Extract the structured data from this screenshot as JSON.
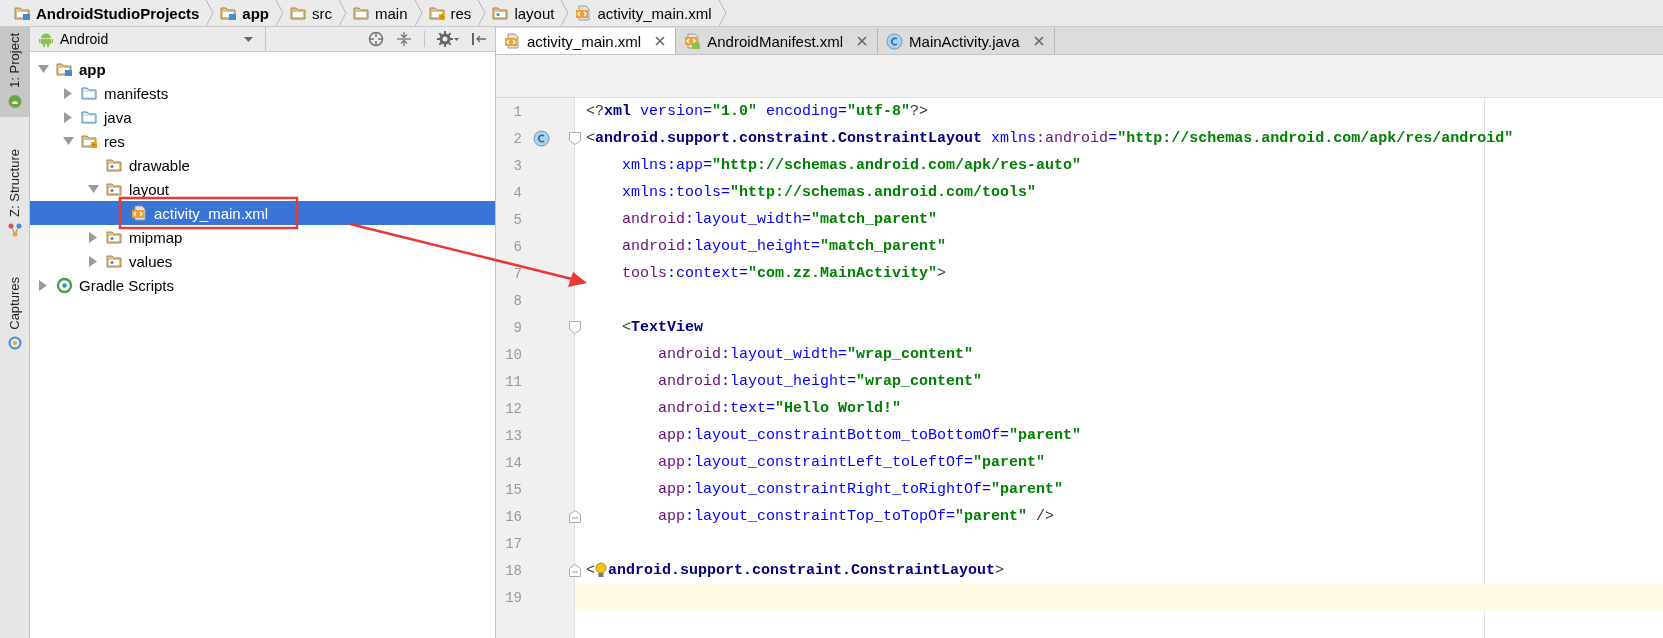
{
  "breadcrumbs": [
    {
      "label": "AndroidStudioProjects",
      "kind": "project"
    },
    {
      "label": "app",
      "kind": "module"
    },
    {
      "label": "src",
      "kind": "folder"
    },
    {
      "label": "main",
      "kind": "folder"
    },
    {
      "label": "res",
      "kind": "res"
    },
    {
      "label": "layout",
      "kind": "resdir"
    },
    {
      "label": "activity_main.xml",
      "kind": "xml"
    }
  ],
  "tool_strip": [
    {
      "label": "1: Project",
      "kind": "project",
      "selected": true
    },
    {
      "label": "Z: Structure",
      "kind": "structure",
      "selected": false
    },
    {
      "label": "Captures",
      "kind": "captures",
      "selected": false
    }
  ],
  "project_panel": {
    "view": "Android",
    "tree": [
      {
        "label": "app",
        "kind": "module",
        "expanded": true,
        "selected": false,
        "children": [
          {
            "label": "manifests",
            "kind": "source",
            "expanded": false,
            "selected": false
          },
          {
            "label": "java",
            "kind": "source",
            "expanded": false,
            "selected": false
          },
          {
            "label": "res",
            "kind": "res",
            "expanded": true,
            "selected": false,
            "children": [
              {
                "label": "drawable",
                "kind": "resdir",
                "selected": false
              },
              {
                "label": "layout",
                "kind": "resdir",
                "expanded": true,
                "selected": false,
                "children": [
                  {
                    "label": "activity_main.xml",
                    "kind": "xml",
                    "selected": true
                  }
                ]
              },
              {
                "label": "mipmap",
                "kind": "resdir",
                "expanded": false,
                "selected": false
              },
              {
                "label": "values",
                "kind": "resdir",
                "expanded": false,
                "selected": false
              }
            ]
          }
        ]
      },
      {
        "label": "Gradle Scripts",
        "kind": "gradle",
        "expanded": false,
        "selected": false
      }
    ]
  },
  "editor": {
    "tabs": [
      {
        "label": "activity_main.xml",
        "kind": "xml",
        "selected": true
      },
      {
        "label": "AndroidManifest.xml",
        "kind": "manifest",
        "selected": false
      },
      {
        "label": "MainActivity.java",
        "kind": "class",
        "selected": false
      }
    ],
    "lines": [
      {
        "number": "1",
        "current": false,
        "tokens": [
          {
            "kind": "punct",
            "text": "<?"
          },
          {
            "kind": "tag",
            "text": "xml"
          },
          {
            "kind": "attr",
            "text": " version="
          },
          {
            "kind": "value",
            "text": "\"1.0\""
          },
          {
            "kind": "attr",
            "text": " encoding="
          },
          {
            "kind": "value",
            "text": "\"utf-8\""
          },
          {
            "kind": "punct",
            "text": "?>"
          }
        ]
      },
      {
        "number": "2",
        "current": false,
        "class_marker": true,
        "fold_start": true,
        "tokens": [
          {
            "kind": "punct",
            "text": "<"
          },
          {
            "kind": "tag",
            "text": "android.support.constraint.ConstraintLayout"
          },
          {
            "kind": "attr",
            "text": " xmlns"
          },
          {
            "kind": "ns",
            "text": ":android"
          },
          {
            "kind": "attr",
            "text": "="
          },
          {
            "kind": "value",
            "text": "\"http://schemas.android.com/apk/res/android\""
          }
        ]
      },
      {
        "number": "3",
        "current": false,
        "tokens": [
          {
            "kind": "attr",
            "text": "    xmlns:app="
          },
          {
            "kind": "value",
            "text": "\"http://schemas.android.com/apk/res-auto\""
          }
        ]
      },
      {
        "number": "4",
        "current": false,
        "tokens": [
          {
            "kind": "attr",
            "text": "    xmlns:tools="
          },
          {
            "kind": "value",
            "text": "\"http://schemas.android.com/tools\""
          }
        ]
      },
      {
        "number": "5",
        "current": false,
        "tokens": [
          {
            "kind": "ns",
            "text": "    android"
          },
          {
            "kind": "attr",
            "text": ":layout_width="
          },
          {
            "kind": "value",
            "text": "\"match_parent\""
          }
        ]
      },
      {
        "number": "6",
        "current": false,
        "tokens": [
          {
            "kind": "ns",
            "text": "    android"
          },
          {
            "kind": "attr",
            "text": ":layout_height="
          },
          {
            "kind": "value",
            "text": "\"match_parent\""
          }
        ]
      },
      {
        "number": "7",
        "current": false,
        "tokens": [
          {
            "kind": "ns",
            "text": "    tools"
          },
          {
            "kind": "attr",
            "text": ":context="
          },
          {
            "kind": "value",
            "text": "\"com.zz.MainActivity\""
          },
          {
            "kind": "punct",
            "text": ">"
          }
        ]
      },
      {
        "number": "8",
        "current": false
      },
      {
        "number": "9",
        "current": false,
        "fold_start": true,
        "tokens": [
          {
            "kind": "punct",
            "text": "    <"
          },
          {
            "kind": "tag",
            "text": "TextView"
          }
        ]
      },
      {
        "number": "10",
        "current": false,
        "tokens": [
          {
            "kind": "ns",
            "text": "        android"
          },
          {
            "kind": "attr",
            "text": ":layout_width="
          },
          {
            "kind": "value",
            "text": "\"wrap_content\""
          }
        ]
      },
      {
        "number": "11",
        "current": false,
        "tokens": [
          {
            "kind": "ns",
            "text": "        android"
          },
          {
            "kind": "attr",
            "text": ":layout_height="
          },
          {
            "kind": "value",
            "text": "\"wrap_content\""
          }
        ]
      },
      {
        "number": "12",
        "current": false,
        "tokens": [
          {
            "kind": "ns",
            "text": "        android"
          },
          {
            "kind": "attr",
            "text": ":text="
          },
          {
            "kind": "value",
            "text": "\"Hello World!\""
          }
        ]
      },
      {
        "number": "13",
        "current": false,
        "tokens": [
          {
            "kind": "ns",
            "text": "        app"
          },
          {
            "kind": "attr",
            "text": ":layout_constraintBottom_toBottomOf="
          },
          {
            "kind": "value",
            "text": "\"parent\""
          }
        ]
      },
      {
        "number": "14",
        "current": false,
        "tokens": [
          {
            "kind": "ns",
            "text": "        app"
          },
          {
            "kind": "attr",
            "text": ":layout_constraintLeft_toLeftOf="
          },
          {
            "kind": "value",
            "text": "\"parent\""
          }
        ]
      },
      {
        "number": "15",
        "current": false,
        "tokens": [
          {
            "kind": "ns",
            "text": "        app"
          },
          {
            "kind": "attr",
            "text": ":layout_constraintRight_toRightOf="
          },
          {
            "kind": "value",
            "text": "\"parent\""
          }
        ]
      },
      {
        "number": "16",
        "current": false,
        "fold_end": true,
        "tokens": [
          {
            "kind": "ns",
            "text": "        app"
          },
          {
            "kind": "attr",
            "text": ":layout_constraintTop_toTopOf="
          },
          {
            "kind": "value",
            "text": "\"parent\""
          },
          {
            "kind": "punct",
            "text": " />"
          }
        ]
      },
      {
        "number": "17",
        "current": false
      },
      {
        "number": "18",
        "current": false,
        "fold_end": true,
        "bulb": true,
        "tokens": [
          {
            "kind": "punct",
            "text": "<"
          },
          {
            "kind": "tag",
            "text": "android.support.constraint.ConstraintLayout",
            "gap": true
          },
          {
            "kind": "punct",
            "text": ">"
          }
        ]
      },
      {
        "number": "19",
        "current": true
      }
    ]
  },
  "callout": {
    "kind": "box-arrow"
  }
}
